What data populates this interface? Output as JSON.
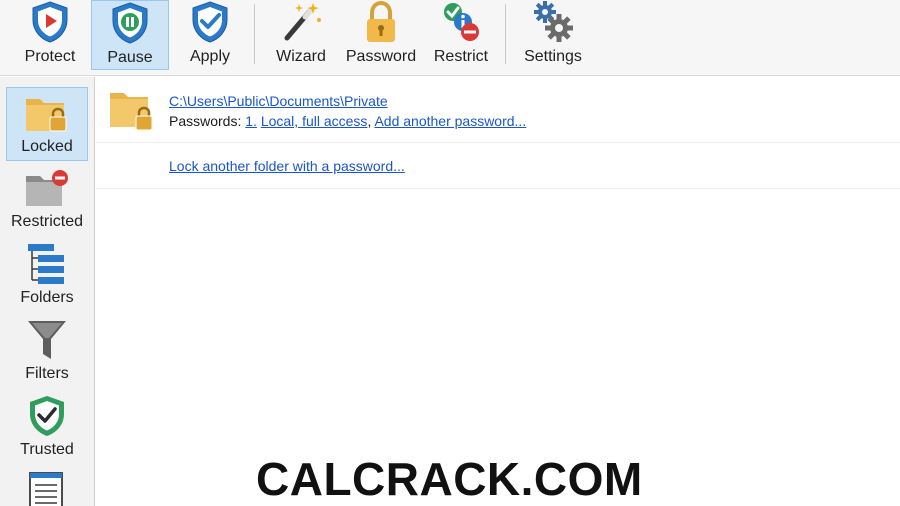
{
  "toolbar": {
    "buttons": [
      {
        "label": "Protect",
        "icon": "shield-play-icon"
      },
      {
        "label": "Pause",
        "icon": "shield-pause-icon"
      },
      {
        "label": "Apply",
        "icon": "shield-check-icon"
      },
      {
        "label": "Wizard",
        "icon": "magic-wand-icon"
      },
      {
        "label": "Password",
        "icon": "padlock-icon"
      },
      {
        "label": "Restrict",
        "icon": "restrict-icon"
      },
      {
        "label": "Settings",
        "icon": "gears-icon"
      }
    ],
    "active": "Pause"
  },
  "sidebar": {
    "items": [
      {
        "label": "Locked",
        "icon": "locked-folder-icon"
      },
      {
        "label": "Restricted",
        "icon": "restricted-folder-icon"
      },
      {
        "label": "Folders",
        "icon": "folder-tree-icon"
      },
      {
        "label": "Filters",
        "icon": "funnel-icon"
      },
      {
        "label": "Trusted",
        "icon": "trusted-shield-icon"
      }
    ],
    "active": "Locked"
  },
  "main": {
    "entries": [
      {
        "path": "C:\\Users\\Public\\Documents\\Private",
        "passwords_label": "Passwords:",
        "password_index": "1.",
        "password_desc": "Local, full access",
        "add_password": "Add another password..."
      }
    ],
    "lock_another": "Lock another folder with a password..."
  },
  "watermark": "CALCRACK.COM",
  "colors": {
    "accent": "#1a56c9",
    "active_bg": "#cde5f7",
    "shield_blue": "#2a7ac9",
    "folder_yellow": "#e8b54a",
    "trusted_green": "#2f9e5d",
    "restrict_red": "#d93a35"
  }
}
